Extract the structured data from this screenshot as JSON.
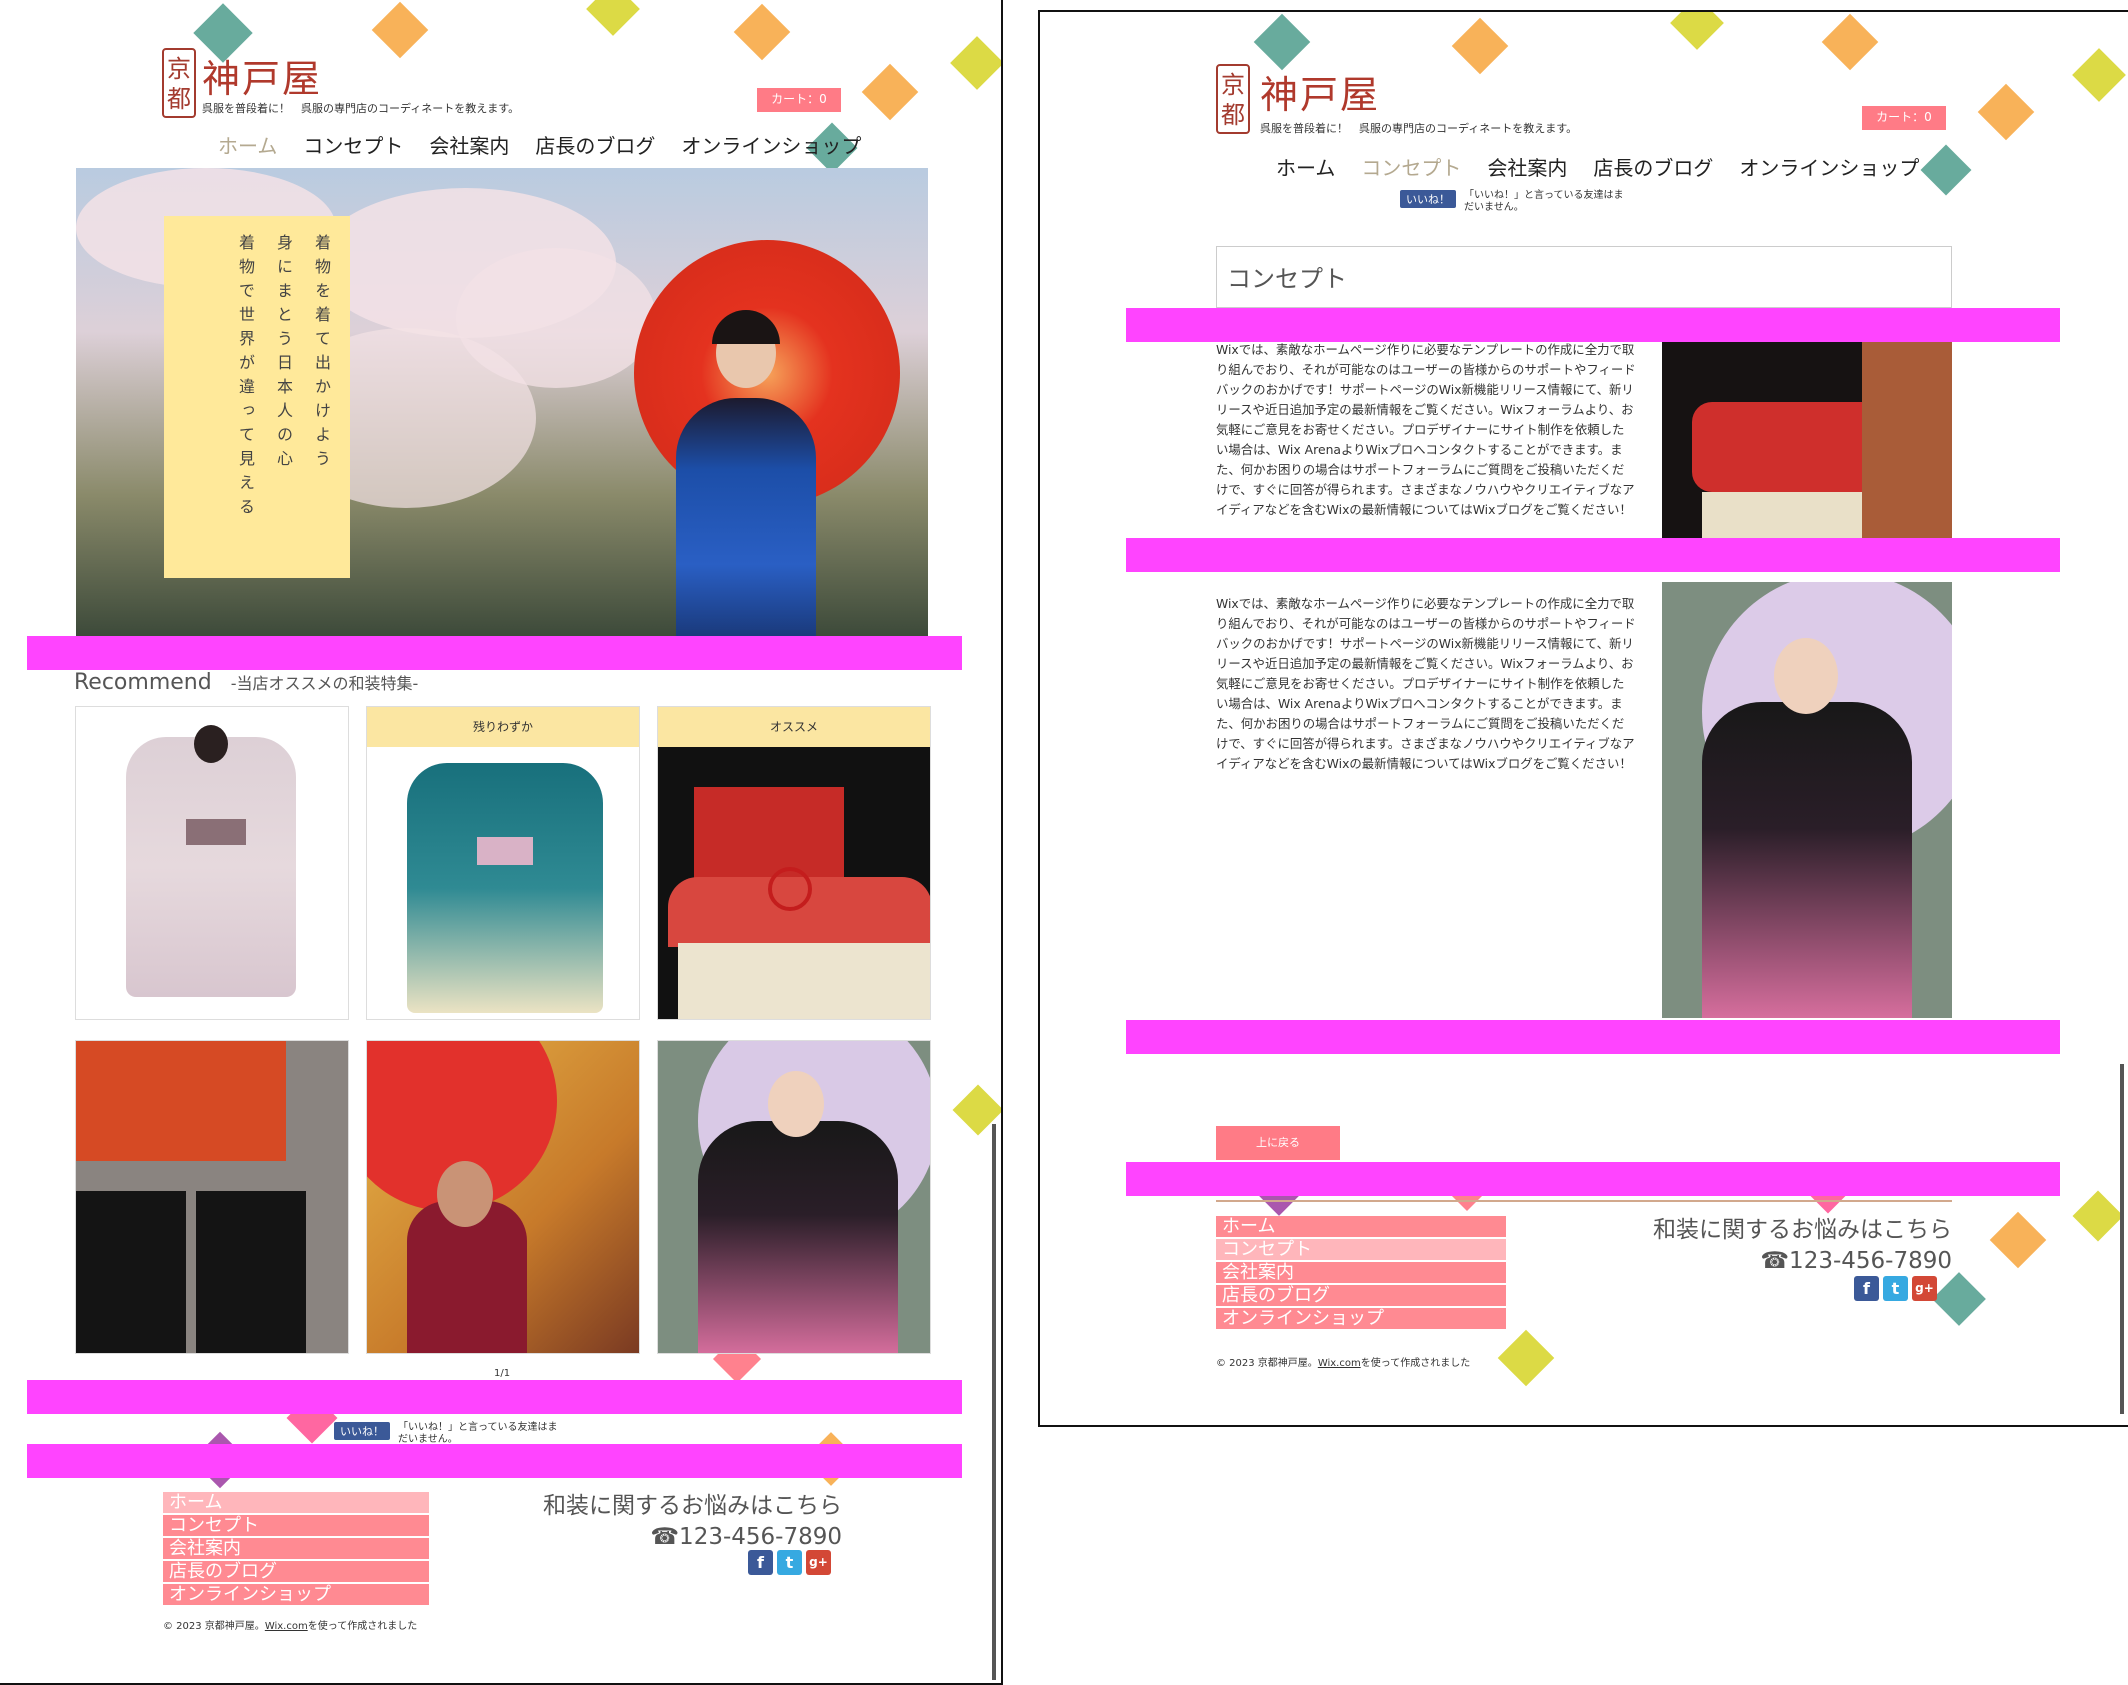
{
  "shop": {
    "seal": "京\n都",
    "name": "神戸屋",
    "tagline": "呉服を普段着に！　呉服の専門店のコーディネートを教えます。",
    "cart": "カート：0"
  },
  "nav": {
    "items": [
      "ホーム",
      "コンセプト",
      "会社案内",
      "店長のブログ",
      "オンラインショップ"
    ]
  },
  "home": {
    "hero_text": "着物を着て出かけよう\n身にまとう日本人の心\n着物で世界が違って見える",
    "recommend_title": "Recommend",
    "recommend_sub": "-当店オススメの和装特集-",
    "card_labels": [
      "残りわずか",
      "オススメ"
    ],
    "pager": "1/1"
  },
  "facebook": {
    "like_button": "いいね！",
    "like_text": "「いいね！」と言っている友達はまだいません。"
  },
  "concept": {
    "title": "コンセプト",
    "paragraph": "Wixでは、素敵なホームページ作りに必要なテンプレートの作成に全力で取り組んでおり、それが可能なのはユーザーの皆様からのサポートやフィードバックのおかげです！サポートページのWix新機能リリース情報にて、新リリースや近日追加予定の最新情報をご覧ください。Wixフォーラムより、お気軽にご意見をお寄せください。プロデザイナーにサイト制作を依頼したい場合は、Wix ArenaよりWixプロへコンタクトすることができます。また、何かお困りの場合はサポートフォーラムにご質問をご投稿いただくだけで、すぐに回答が得られます。さまざまなノウハウやクリエイティブなアイディアなどを含むWixの最新情報についてはWixブログをご覧ください！",
    "back_to_top": "上に戻る"
  },
  "footer": {
    "question": "和装に関するお悩みはこちら",
    "phone": "☎123-456-7890",
    "copyright_pre": "© 2023 京都神戸屋。",
    "copyright_link": "Wix.com",
    "copyright_post": "を使って作成されました",
    "social": [
      "f",
      "t",
      "g+"
    ]
  },
  "colors": {
    "accent": "#ff7b86",
    "brand": "#b0392c",
    "highlight": "#ff44ff",
    "note": "#ffe99a"
  }
}
